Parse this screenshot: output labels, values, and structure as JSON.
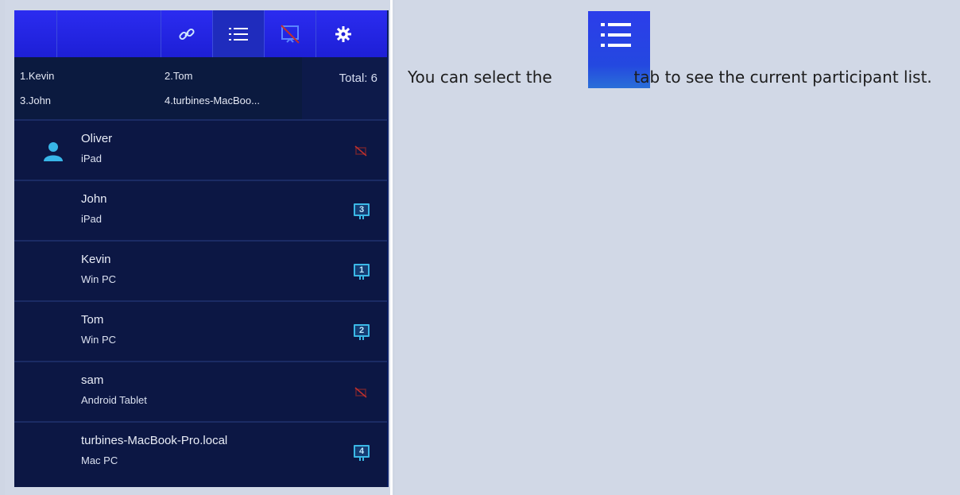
{
  "app": {
    "toolbar": {
      "icons": [
        "link-icon",
        "list-icon",
        "screen-off-icon",
        "gear-icon"
      ],
      "active": "list-icon"
    },
    "summary": {
      "items": [
        "1.Kevin",
        "2.Tom",
        "3.John",
        "4.turbines-MacBoo..."
      ],
      "total": "Total: 6"
    },
    "participants": [
      {
        "name": "Oliver",
        "device": "iPad",
        "status": "not-presenting",
        "badge": ""
      },
      {
        "name": "John",
        "device": "iPad",
        "status": "screen",
        "badge": "3"
      },
      {
        "name": "Kevin",
        "device": "Win PC",
        "status": "screen",
        "badge": "1"
      },
      {
        "name": "Tom",
        "device": "Win PC",
        "status": "screen",
        "badge": "2"
      },
      {
        "name": "sam",
        "device": "Android Tablet",
        "status": "not-presenting",
        "badge": ""
      },
      {
        "name": "turbines-MacBook-Pro.local",
        "device": "Mac PC",
        "status": "screen",
        "badge": "4"
      }
    ]
  },
  "instructions": {
    "before": "You can select the",
    "after": "tab to see the current participant list."
  },
  "colors": {
    "toolbar": "#2b2cf0",
    "background": "#0c1744",
    "accent": "#3bb8e6",
    "page": "#d1d8e6"
  }
}
